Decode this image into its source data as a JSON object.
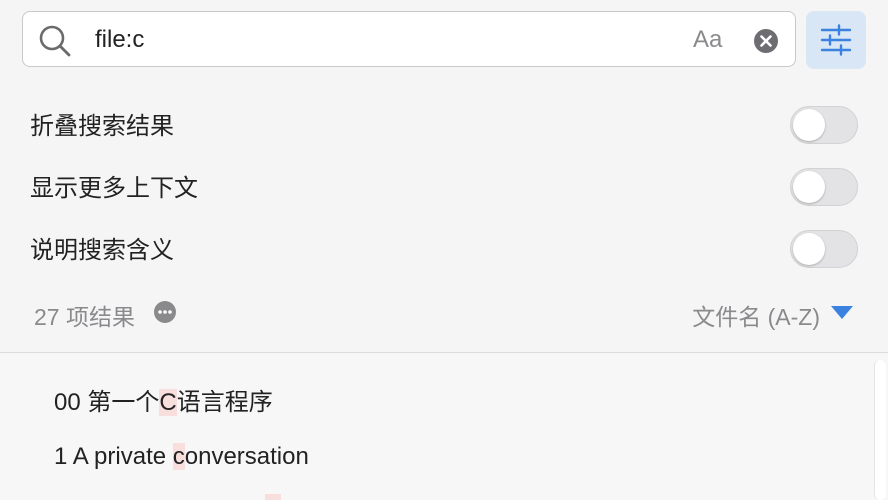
{
  "search": {
    "query": "file:c",
    "case_toggle_label": "Aa",
    "icons": {
      "search": "search-icon",
      "clear": "clear-circle-icon",
      "filter": "sliders-icon"
    }
  },
  "options": [
    {
      "label": "折叠搜索结果",
      "enabled": false
    },
    {
      "label": "显示更多上下文",
      "enabled": false
    },
    {
      "label": "说明搜索含义",
      "enabled": false
    }
  ],
  "summary": {
    "result_count": "27 项结果",
    "more_icon": "ellipsis-circle-icon",
    "sort_label": "文件名 (A-Z)",
    "sort_caret_icon": "caret-down-icon"
  },
  "results": [
    {
      "prefix": "00 第一个",
      "match": "C",
      "suffix": "语言程序"
    },
    {
      "prefix": "1 A private ",
      "match": "c",
      "suffix": "onversation"
    }
  ],
  "colors": {
    "accent": "#3b82e0",
    "highlight": "#f9dede",
    "filter_button_bg": "#d8e6f6"
  }
}
